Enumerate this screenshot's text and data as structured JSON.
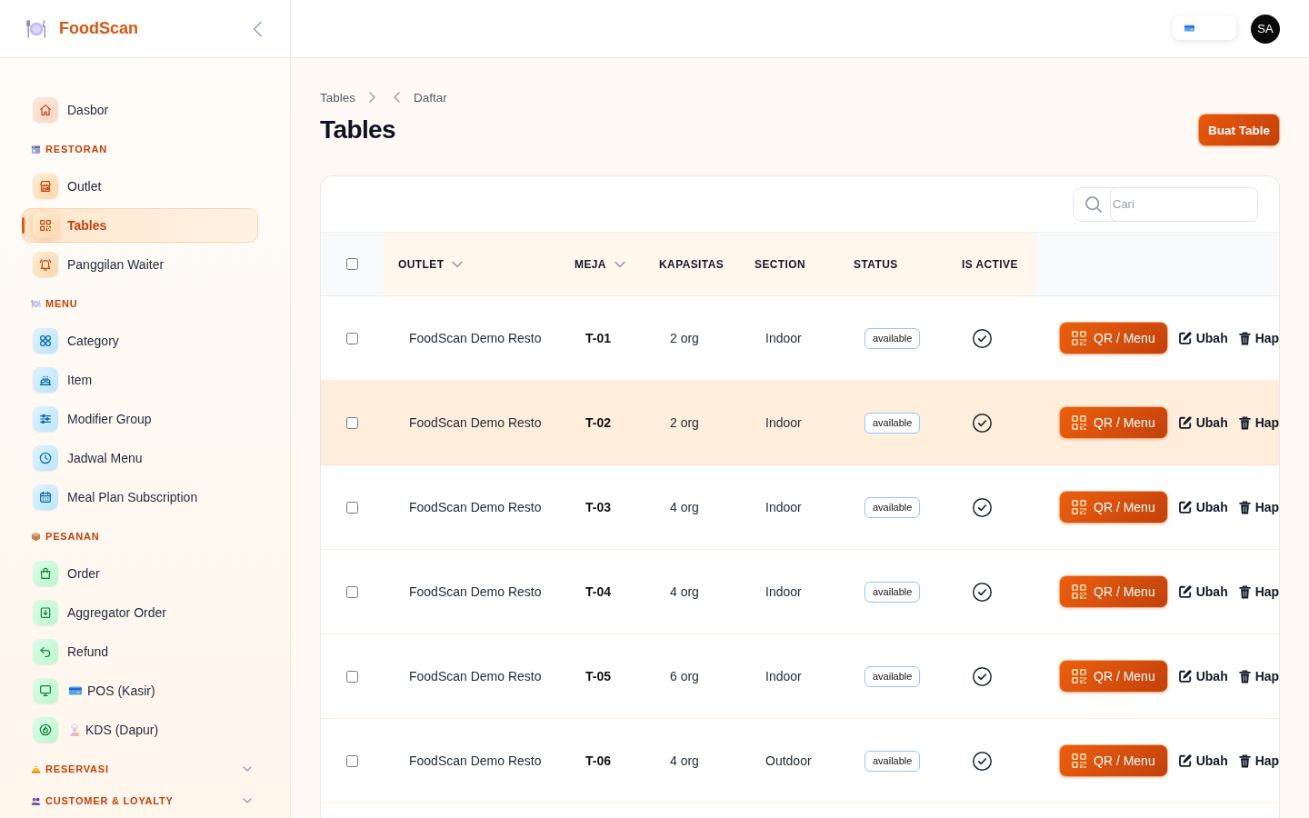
{
  "sidebar": {
    "brand": "FoodScan",
    "groups": [
      {
        "items": [
          {
            "label": "Dasbor",
            "kind": "plain",
            "selected": false
          }
        ]
      },
      {
        "title": "RESTORAN",
        "expanded": true,
        "items": [
          {
            "label": "Outlet",
            "kind": "plain",
            "selected": false
          },
          {
            "label": "Tables",
            "kind": "plain",
            "selected": true
          },
          {
            "label": "Panggilan Waiter",
            "kind": "plain",
            "selected": false
          }
        ]
      },
      {
        "title": "MENU",
        "expanded": true,
        "items": [
          {
            "label": "Category",
            "kind": "plain",
            "selected": false
          },
          {
            "label": "Item",
            "kind": "plain",
            "selected": false
          },
          {
            "label": "Modifier Group",
            "kind": "plain",
            "selected": false
          },
          {
            "label": "Jadwal Menu",
            "kind": "plain",
            "selected": false
          },
          {
            "label": "Meal Plan Subscription",
            "kind": "plain",
            "selected": false
          }
        ]
      },
      {
        "title": "PESANAN",
        "expanded": true,
        "items": [
          {
            "label": "Order",
            "kind": "plain",
            "selected": false
          },
          {
            "label": "Aggregator Order",
            "kind": "plain",
            "selected": false
          },
          {
            "label": "Refund",
            "kind": "plain",
            "selected": false
          },
          {
            "label": "POS (Kasir)",
            "kind": "prefixed",
            "selected": false
          },
          {
            "label": "KDS (Dapur)",
            "kind": "prefixed",
            "selected": false
          }
        ]
      },
      {
        "title": "RESERVASI",
        "expanded": false
      },
      {
        "title": "CUSTOMER & LOYALTY",
        "expanded": false
      }
    ]
  },
  "topbar": {
    "avatar": "SA"
  },
  "page": {
    "breadcrumb": [
      {
        "label": "Tables",
        "kind": "link"
      },
      {
        "label": "Daftar",
        "kind": "current"
      }
    ],
    "title": "Tables",
    "create_button": "Buat Table"
  },
  "table": {
    "search": {
      "placeholder": "Cari"
    },
    "select_all": {
      "checked": false
    },
    "columns": [
      {
        "label": "OUTLET",
        "sortable": true
      },
      {
        "label": "MEJA",
        "sortable": true
      },
      {
        "label": "KAPASITAS",
        "sortable": false
      },
      {
        "label": "SECTION",
        "sortable": false
      },
      {
        "label": "STATUS",
        "sortable": false
      },
      {
        "label": "IS ACTIVE",
        "sortable": false
      }
    ],
    "rows": [
      {
        "checked": false,
        "highlighted": false,
        "outlet": "FoodScan Demo Resto",
        "meja": "T-01",
        "kapasitas": "2 org",
        "section": "Indoor",
        "status": "available",
        "active": true,
        "actions": [
          {
            "kind": "qr",
            "label": "QR / Menu"
          },
          {
            "kind": "edit",
            "label": "Ubah"
          },
          {
            "kind": "delete",
            "label": "Hap"
          }
        ]
      },
      {
        "checked": false,
        "highlighted": true,
        "outlet": "FoodScan Demo Resto",
        "meja": "T-02",
        "kapasitas": "2 org",
        "section": "Indoor",
        "status": "available",
        "active": true,
        "actions": [
          {
            "kind": "qr",
            "label": "QR / Menu"
          },
          {
            "kind": "edit",
            "label": "Ubah"
          },
          {
            "kind": "delete",
            "label": "Hap"
          }
        ]
      },
      {
        "checked": false,
        "highlighted": false,
        "outlet": "FoodScan Demo Resto",
        "meja": "T-03",
        "kapasitas": "4 org",
        "section": "Indoor",
        "status": "available",
        "active": true,
        "actions": [
          {
            "kind": "qr",
            "label": "QR / Menu"
          },
          {
            "kind": "edit",
            "label": "Ubah"
          },
          {
            "kind": "delete",
            "label": "Hap"
          }
        ]
      },
      {
        "checked": false,
        "highlighted": false,
        "outlet": "FoodScan Demo Resto",
        "meja": "T-04",
        "kapasitas": "4 org",
        "section": "Indoor",
        "status": "available",
        "active": true,
        "actions": [
          {
            "kind": "qr",
            "label": "QR / Menu"
          },
          {
            "kind": "edit",
            "label": "Ubah"
          },
          {
            "kind": "delete",
            "label": "Hap"
          }
        ]
      },
      {
        "checked": false,
        "highlighted": false,
        "outlet": "FoodScan Demo Resto",
        "meja": "T-05",
        "kapasitas": "6 org",
        "section": "Indoor",
        "status": "available",
        "active": true,
        "actions": [
          {
            "kind": "qr",
            "label": "QR / Menu"
          },
          {
            "kind": "edit",
            "label": "Ubah"
          },
          {
            "kind": "delete",
            "label": "Hap"
          }
        ]
      },
      {
        "checked": false,
        "highlighted": false,
        "outlet": "FoodScan Demo Resto",
        "meja": "T-06",
        "kapasitas": "4 org",
        "section": "Outdoor",
        "status": "available",
        "active": true,
        "actions": [
          {
            "kind": "qr",
            "label": "QR / Menu"
          },
          {
            "kind": "edit",
            "label": "Ubah"
          },
          {
            "kind": "delete",
            "label": "Hap"
          }
        ]
      }
    ]
  }
}
